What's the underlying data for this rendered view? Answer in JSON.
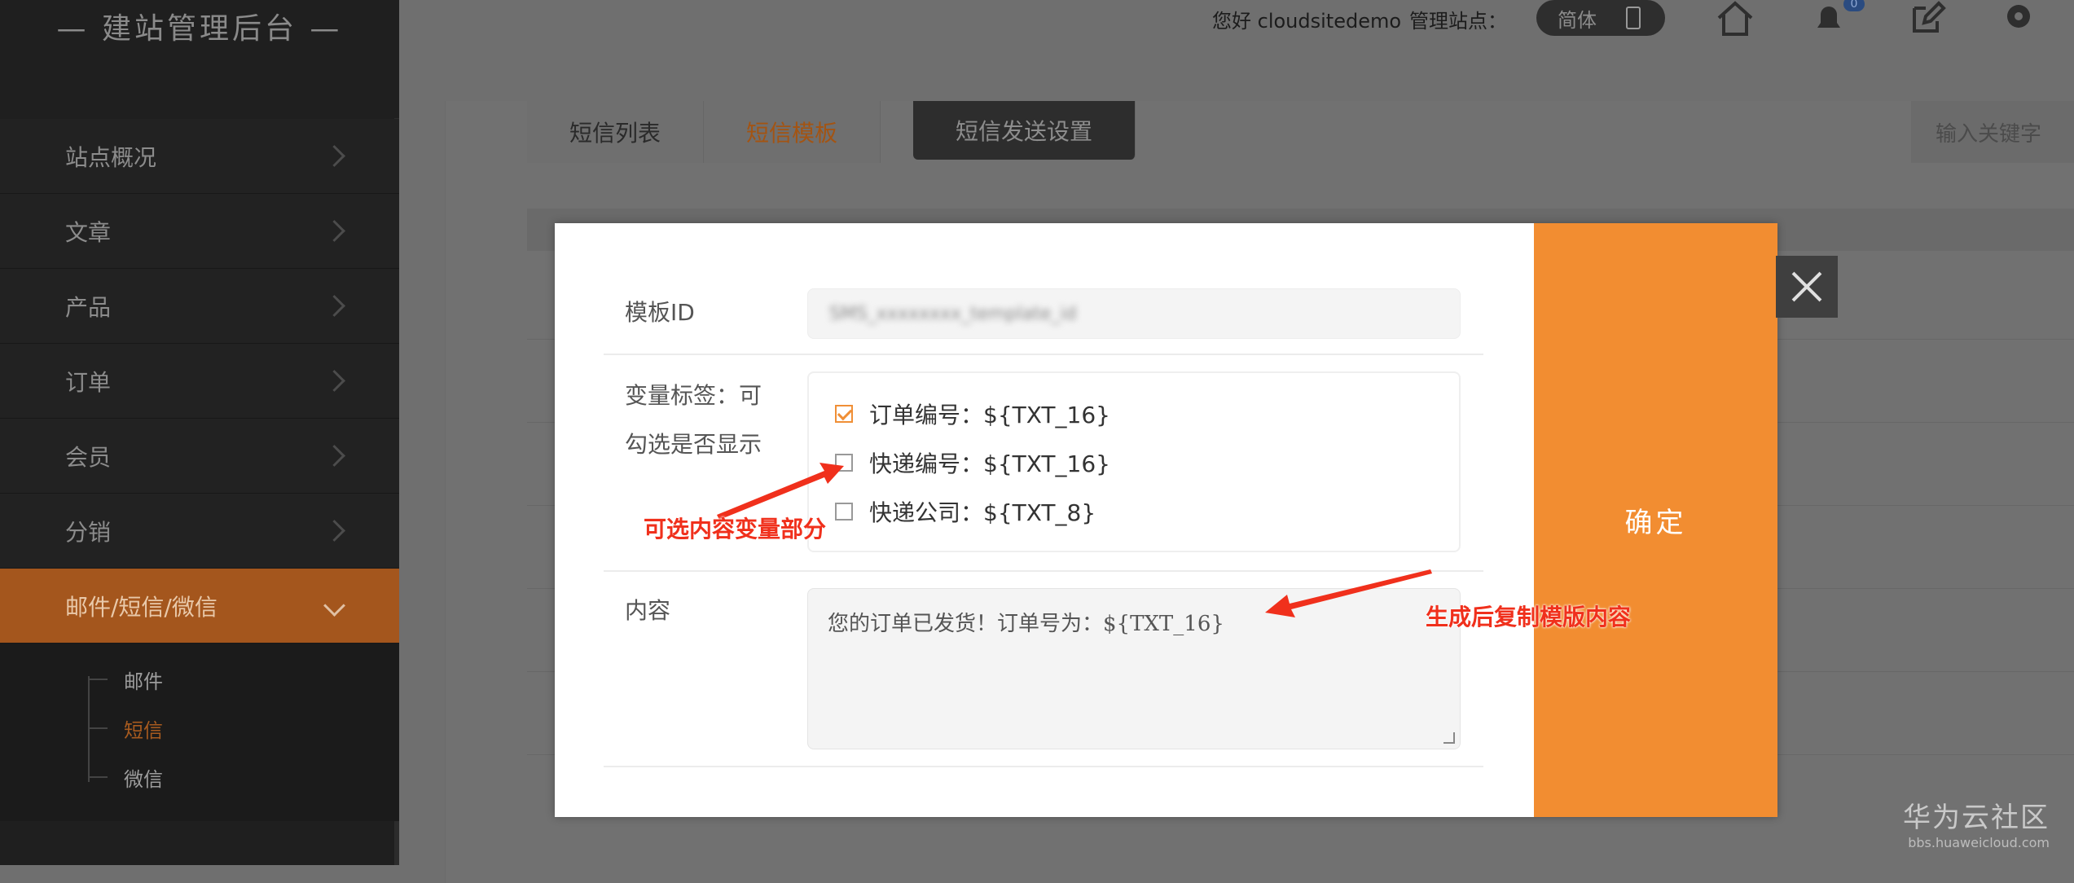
{
  "app": {
    "brand": "— 建站管理后台 —"
  },
  "sidebar": {
    "items": [
      {
        "label": "站点概况"
      },
      {
        "label": "文章"
      },
      {
        "label": "产品"
      },
      {
        "label": "订单"
      },
      {
        "label": "会员"
      },
      {
        "label": "分销"
      },
      {
        "label": "邮件/短信/微信",
        "active": true
      }
    ],
    "subitems": [
      {
        "label": "邮件"
      },
      {
        "label": "短信",
        "active": true
      },
      {
        "label": "微信"
      }
    ]
  },
  "topbar": {
    "greeting": "您好 cloudsitedemo",
    "site_label": "管理站点：",
    "lang_toggle": "简体",
    "notification_count": "0",
    "icons": [
      "home-icon",
      "bell-icon",
      "edit-icon",
      "gear-icon"
    ]
  },
  "tabs": [
    {
      "label": "短信列表"
    },
    {
      "label": "短信模板",
      "active": true
    },
    {
      "label": "短信发送设置"
    }
  ],
  "search": {
    "placeholder": "输入关键字"
  },
  "modal": {
    "template_id_label": "模板ID",
    "template_id_value": "SMS_xxxxxxxx_template_id",
    "tags_label_line1": "变量标签：可",
    "tags_label_line2": "勾选是否显示",
    "tags": [
      {
        "label": "订单编号：${TXT_16}",
        "checked": true
      },
      {
        "label": "快递编号：${TXT_16}",
        "checked": false
      },
      {
        "label": "快递公司：${TXT_8}",
        "checked": false
      }
    ],
    "content_label": "内容",
    "content_value": "您的订单已发货！订单号为：${TXT_16}",
    "confirm_label": "确定"
  },
  "annotations": {
    "tags_note": "可选内容变量部分",
    "content_note": "生成后复制模版内容",
    "color": "#f0301c"
  },
  "watermark": {
    "title": "华为云社区",
    "url": "bbs.huaweicloud.com"
  },
  "colors": {
    "accent": "#f28d31",
    "sidebar_bg": "#1f1f1f"
  }
}
